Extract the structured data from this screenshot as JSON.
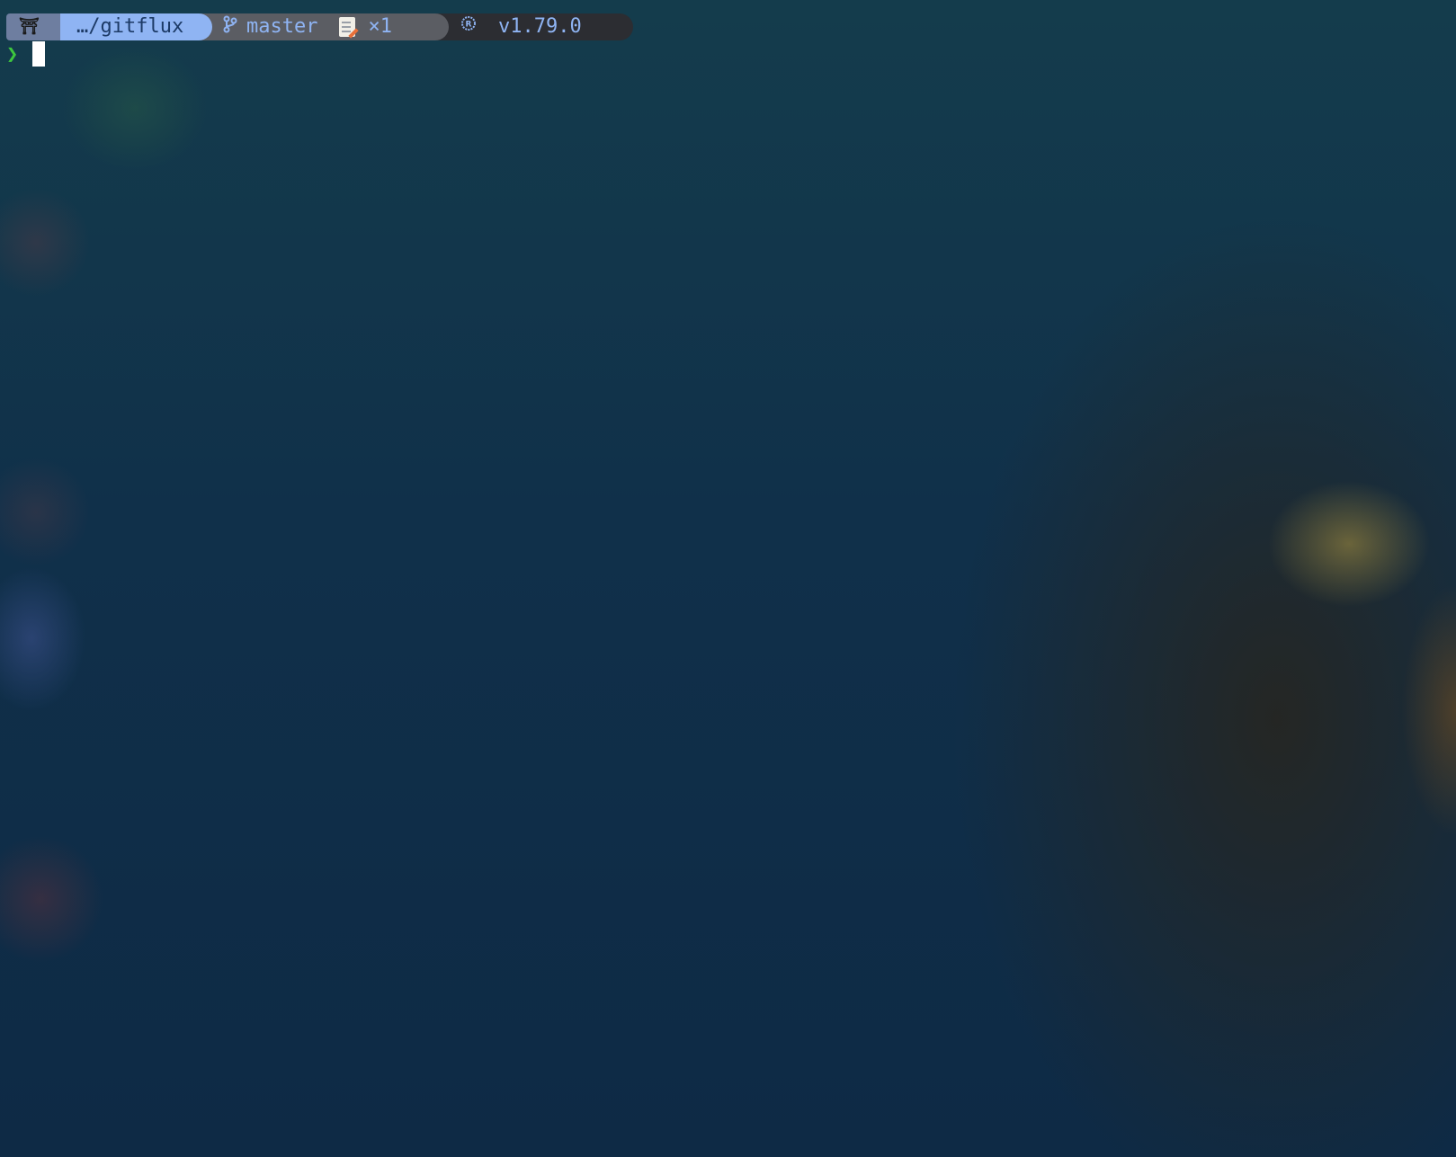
{
  "prompt": {
    "os_icon": "torii-icon",
    "directory": "…/gitflux",
    "git": {
      "branch_icon": "git-branch-icon",
      "branch": "master",
      "modified_icon": "memo-icon",
      "modified_count": "×1"
    },
    "rust": {
      "icon": "rust-icon",
      "version": "v1.79.0"
    },
    "prompt_char": "❯"
  },
  "colors": {
    "dir_segment": "#8fb4f3",
    "git_segment": "#5b5d63",
    "rust_segment": "#2c2d32",
    "prompt_char": "#3ec73e",
    "cursor": "#ffffff"
  }
}
